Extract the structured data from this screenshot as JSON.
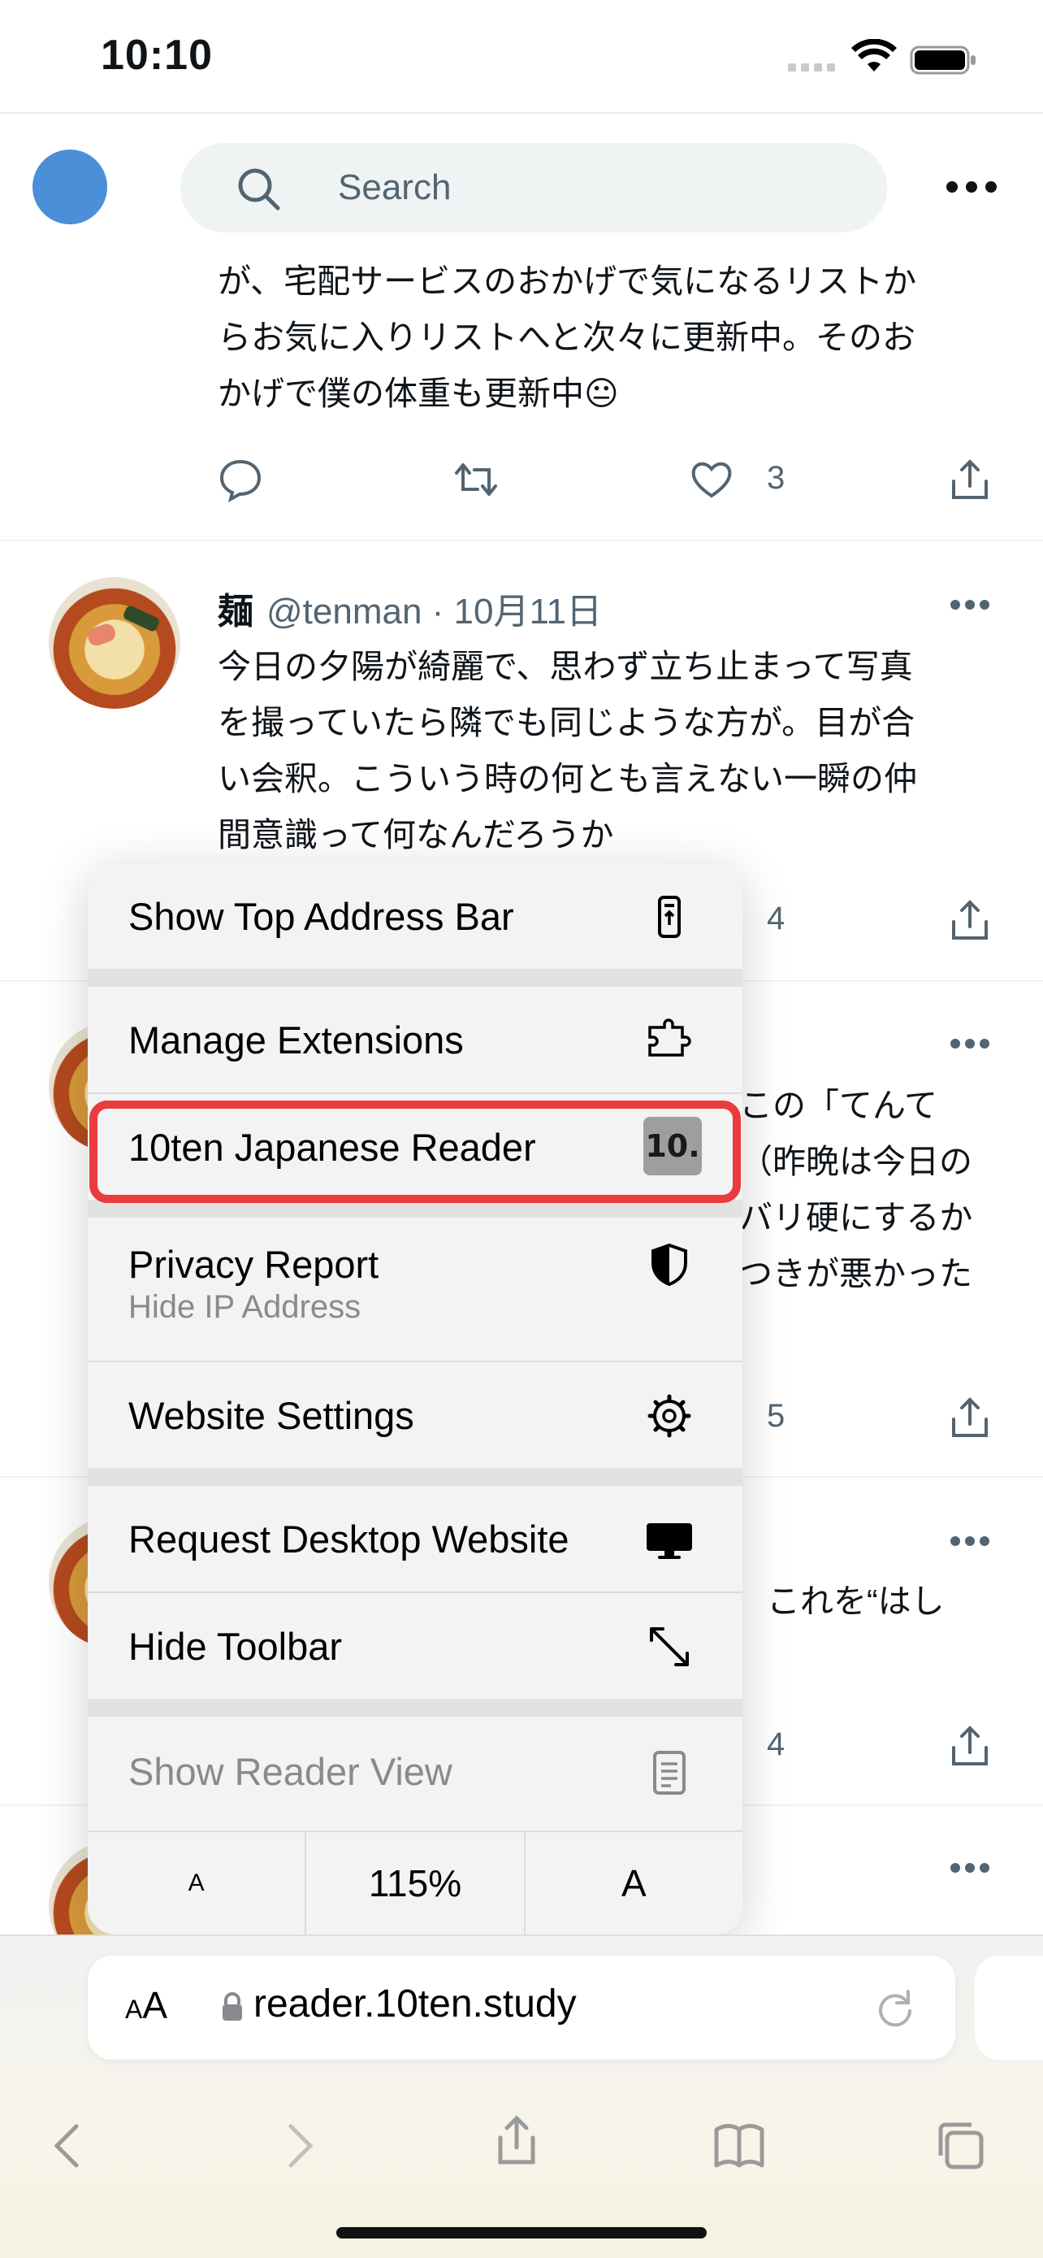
{
  "status": {
    "time": "10:10"
  },
  "header": {
    "search_placeholder": "Search"
  },
  "tweets": [
    {
      "text_lines": [
        "が、宅配サービスのおかげで気になるリストか",
        "らお気に入りリストへと次々に更新中。そのお",
        "かげで僕の体重も更新中😐"
      ],
      "likes": "3"
    },
    {
      "name": "麺",
      "handle": "@tenman · 10月11日",
      "text_lines": [
        "今日の夕陽が綺麗で、思わず立ち止まって写真",
        "を撮っていたら隣でも同じような方が。目が合",
        "い会釈。こういう時の何とも言えない一瞬の仲",
        "間意識って何なんだろうか"
      ],
      "likes": "4"
    },
    {
      "text_fragments": [
        "この「てんて",
        "（昨晩は今日の",
        "バリ硬にするか",
        "つきが悪かった"
      ],
      "likes": "5"
    },
    {
      "text_fragments": [
        "これを“はし"
      ],
      "likes": "4"
    }
  ],
  "menu": {
    "items": [
      {
        "label": "Show Top Address Bar",
        "icon": "top-address-bar-icon"
      },
      {
        "label": "Manage Extensions",
        "icon": "puzzle-icon"
      },
      {
        "label": "10ten Japanese Reader",
        "icon": "10ten-extension-icon",
        "badge": "10."
      },
      {
        "label": "Privacy Report",
        "sublabel": "Hide IP Address",
        "icon": "shield-icon"
      },
      {
        "label": "Website Settings",
        "icon": "gear-icon"
      },
      {
        "label": "Request Desktop Website",
        "icon": "desktop-icon"
      },
      {
        "label": "Hide Toolbar",
        "icon": "expand-arrows-icon"
      },
      {
        "label": "Show Reader View",
        "icon": "reader-icon",
        "disabled": true
      }
    ],
    "zoom": {
      "decrease": "A",
      "level": "115%",
      "increase": "A"
    }
  },
  "address_bar": {
    "aa_small": "A",
    "aa_large": "A",
    "url": "reader.10ten.study"
  },
  "colors": {
    "highlight": "#ea3b3d",
    "twitter_gray": "#536471"
  }
}
